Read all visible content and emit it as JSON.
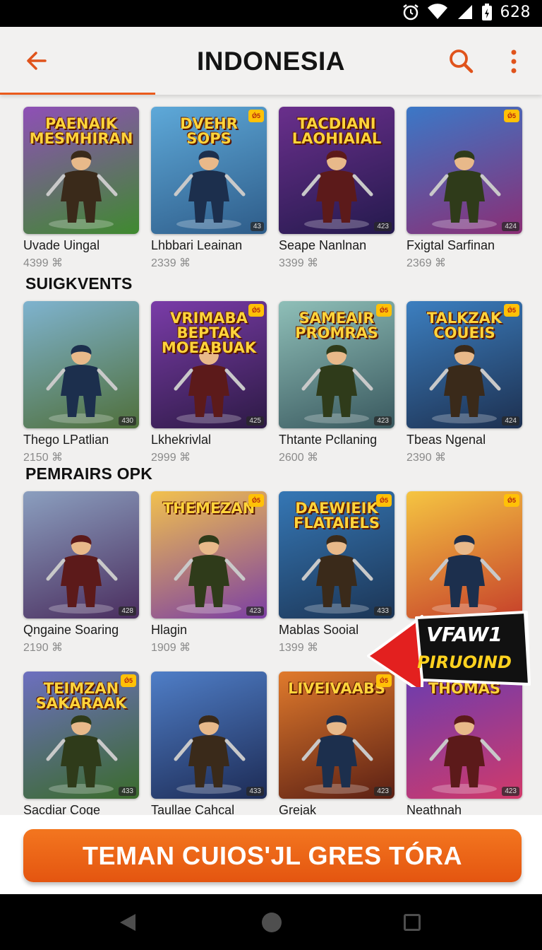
{
  "status_bar": {
    "time": "628"
  },
  "app_bar": {
    "title": "INDONESIA"
  },
  "sections": [
    {
      "title": "SUIGKVENTS"
    },
    {
      "title": "PEMRAIRS OPK"
    }
  ],
  "rows": [
    [
      {
        "name": "Uvade Uingal",
        "count": "4399 ⌘",
        "art_text": "PAENAIK MESMHIRAN",
        "colors": [
          "#8f4fb7",
          "#3f8a2f"
        ],
        "badge": "",
        "rating": ""
      },
      {
        "name": "Lhbbari Leainan",
        "count": "2339 ⌘",
        "art_text": "DVEHR SOPS",
        "colors": [
          "#5ea9d9",
          "#2e5c89"
        ],
        "badge": "Ǿ5",
        "rating": "43"
      },
      {
        "name": "Seape Nanlnan",
        "count": "3399 ⌘",
        "art_text": "TACDIANI LAOHIAIAL",
        "colors": [
          "#6a2f8c",
          "#241a4d"
        ],
        "badge": "",
        "rating": "423"
      },
      {
        "name": "Fxigtal Sarfinan",
        "count": "2369 ⌘",
        "art_text": "",
        "colors": [
          "#3b78c7",
          "#8b2e75"
        ],
        "badge": "Ǿ5",
        "rating": "424"
      }
    ],
    [
      {
        "name": "Thego LPatlian",
        "count": "2150 ⌘",
        "art_text": "",
        "colors": [
          "#7fb3cf",
          "#4f6f3a"
        ],
        "badge": "",
        "rating": "430"
      },
      {
        "name": "Lkhekrivlal",
        "count": "2999 ⌘",
        "art_text": "VRIMABA BEPTAK MOEABUAK",
        "colors": [
          "#7a3ca8",
          "#2d1a45"
        ],
        "badge": "Ǿ5",
        "rating": "425"
      },
      {
        "name": "Thtante Pcllaning",
        "count": "2600 ⌘",
        "art_text": "SAMEAIR PROMRAS",
        "colors": [
          "#8fbfb8",
          "#39585e"
        ],
        "badge": "Ǿ5",
        "rating": "423"
      },
      {
        "name": "Tbeas Ngenal",
        "count": "2390 ⌘",
        "art_text": "TALKZAK COUEIS",
        "colors": [
          "#3c7fc0",
          "#1d3050"
        ],
        "badge": "Ǿ5",
        "rating": "424"
      }
    ],
    [
      {
        "name": "Qngaine Soaring",
        "count": "2190 ⌘",
        "art_text": "",
        "colors": [
          "#8b9fbf",
          "#4a2d5e"
        ],
        "badge": "",
        "rating": "428"
      },
      {
        "name": "Hlagin",
        "count": "1909 ⌘",
        "art_text": "THEMEZAN",
        "colors": [
          "#f2c14e",
          "#7b3fa3"
        ],
        "badge": "Ǿ5",
        "rating": "423"
      },
      {
        "name": "Mablas Sooial",
        "count": "1399 ⌘",
        "art_text": "DAEWIEIK FLATAIELS",
        "colors": [
          "#3577b5",
          "#1c3555"
        ],
        "badge": "Ǿ5",
        "rating": "433"
      },
      {
        "name": "",
        "count": "",
        "art_text": "",
        "colors": [
          "#f5c542",
          "#c6402a"
        ],
        "badge": "Ǿ5",
        "rating": ""
      }
    ],
    [
      {
        "name": "Sacdiar Coge",
        "count": "",
        "art_text": "TEIMZAN SAKARAAK",
        "colors": [
          "#6d6fc0",
          "#3a6b2b"
        ],
        "badge": "Ǿ5",
        "rating": "433"
      },
      {
        "name": "Taullae Cahcal",
        "count": "",
        "art_text": "",
        "colors": [
          "#4f7ec7",
          "#1d2b55"
        ],
        "badge": "",
        "rating": "433"
      },
      {
        "name": "Grejak",
        "count": "",
        "art_text": "LIVEIVAABS",
        "colors": [
          "#e07a2c",
          "#5a1f14"
        ],
        "badge": "Ǿ5",
        "rating": "423"
      },
      {
        "name": "Neathnah",
        "count": "",
        "art_text": "THOMAS",
        "colors": [
          "#6a3cb0",
          "#d13a6a"
        ],
        "badge": "",
        "rating": "423"
      }
    ]
  ],
  "promo": {
    "line1": "VFAW1",
    "line2": "PIRUOIND"
  },
  "cta": {
    "label": "TEMAN CUIOS'JL GRES TÓRA"
  },
  "theme": {
    "accent": "#ea5a1c",
    "promo_red": "#e3201f",
    "promo_yellow": "#ffd21f"
  }
}
